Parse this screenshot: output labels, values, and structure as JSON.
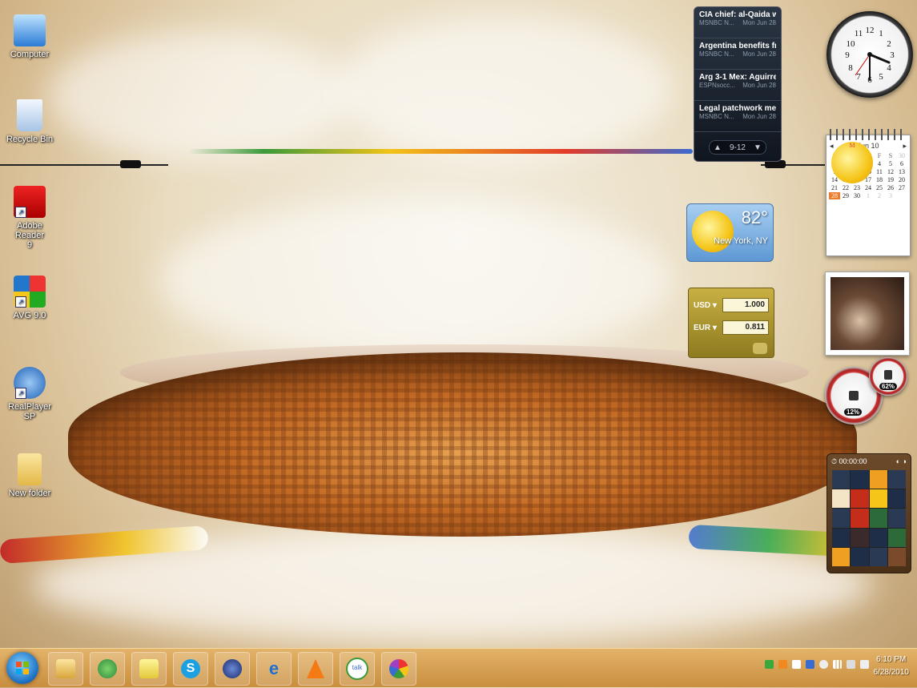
{
  "desktop_icons": [
    {
      "label": "Computer"
    },
    {
      "label": "Recycle Bin"
    },
    {
      "label": "Adobe Reader 9"
    },
    {
      "label": "AVG 9.0"
    },
    {
      "label": "RealPlayer SP"
    },
    {
      "label": "New folder"
    }
  ],
  "news": {
    "items": [
      {
        "title": "CIA chief: al-Qaida w...",
        "source": "MSNBC N...",
        "date": "Mon Jun 28"
      },
      {
        "title": "Argentina benefits fr...",
        "source": "MSNBC N...",
        "date": "Mon Jun 28"
      },
      {
        "title": "Arg 3-1 Mex: Aguirre...",
        "source": "ESPNsocc...",
        "date": "Mon Jun 28"
      },
      {
        "title": "Legal patchwork me...",
        "source": "MSNBC N...",
        "date": "Mon Jun 28"
      }
    ],
    "pager": "9-12"
  },
  "calendar": {
    "month": "Jun 10",
    "weekdays": [
      "S",
      "M",
      "T",
      "W",
      "T",
      "F",
      "S"
    ],
    "days": [
      [
        "30",
        "31",
        "1",
        "2",
        "3",
        "4",
        "5"
      ],
      [
        "6",
        "7",
        "8",
        "9",
        "10",
        "11",
        "12"
      ],
      [
        "13",
        "14",
        "15",
        "16",
        "17",
        "18",
        "19"
      ],
      [
        "20",
        "21",
        "22",
        "23",
        "24",
        "25",
        "26"
      ],
      [
        "27",
        "28",
        "29",
        "30",
        "1",
        "2",
        "3"
      ]
    ],
    "today": "28"
  },
  "weather": {
    "temp": "82°",
    "city": "New York, NY"
  },
  "currency": {
    "rows": [
      {
        "code": "USD",
        "value": "1.000"
      },
      {
        "code": "EUR",
        "value": "0.811"
      }
    ]
  },
  "meters": {
    "cpu": "12%",
    "memory": "62%"
  },
  "puzzle": {
    "time": "00:00:00"
  },
  "taskbar": {
    "time": "6:10 PM",
    "date": "6/28/2010",
    "apps": [
      "windows-explorer",
      "people",
      "notes",
      "skype",
      "media",
      "internet-explorer",
      "vlc",
      "google-talk",
      "picasa"
    ]
  },
  "colors": {
    "taskbar": "#d9a055",
    "accent": "#f07b2a",
    "news_bg": "#1b2430"
  }
}
